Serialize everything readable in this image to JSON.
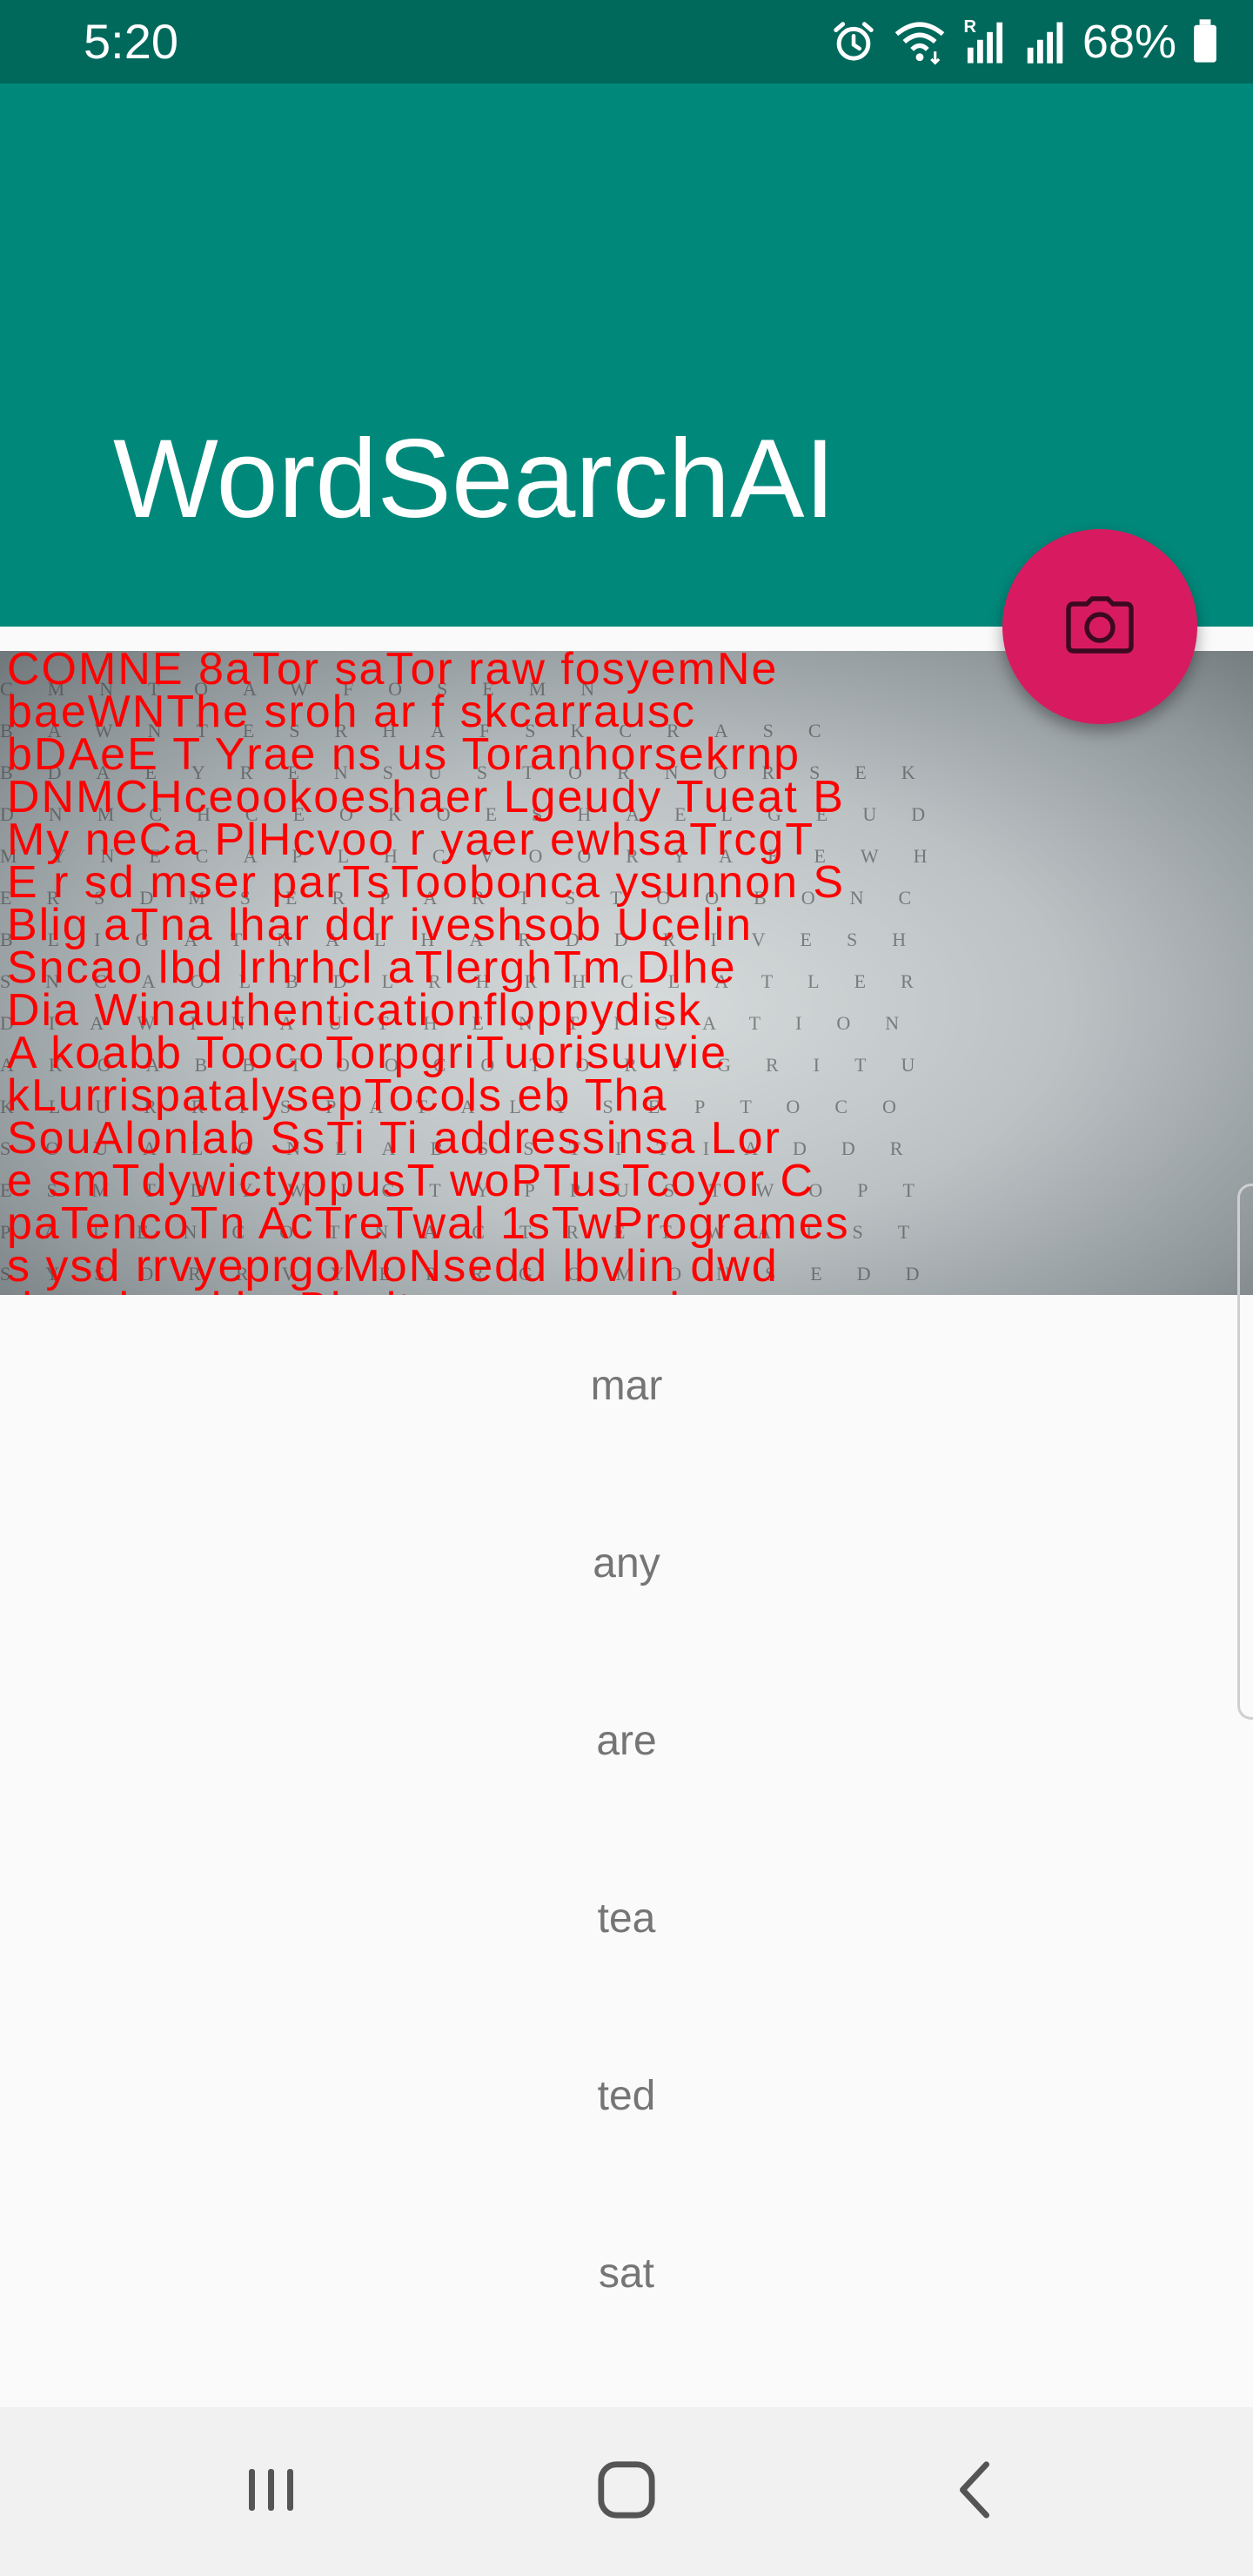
{
  "status_bar": {
    "time": "5:20",
    "battery_percent": "68%",
    "icons": [
      "alarm-icon",
      "wifi-icon",
      "signal-roaming-icon",
      "signal-icon",
      "battery-icon"
    ]
  },
  "app_bar": {
    "title": "WordSearchAI",
    "background_color": "#00897b",
    "status_bar_color": "#00695c"
  },
  "fab": {
    "icon": "camera-icon",
    "color": "#d81b60"
  },
  "ocr_overlay": {
    "color": "#ff0000",
    "lines": [
      "COMNE 8aTor saTor  raw  fosyemNe",
      "baeWNThe sroh  ar f  skcarrausc",
      "bDAeE T Yrae ns us Toranhorsekrnp",
      " DNMCHceookoeshaer Lgeudy Tueat B",
      "My  neCa PlHcvoo   r yaer ewhsaTrcgT",
      " E r sd mser parTsToobonca   ysunnon S",
      "Blig  aTna lhar ddr iveshsob Ucelin",
      "Sncao lbd lrhrhcl aTlerghTm Dlhe",
      "  Dia Winauthenticationfloppydisk",
      " A  koabb   ToocoTorpgriTuorisuuvie",
      "kLurrispatalysepTocols eb  Tha",
      "SouAlonlab SsTi Ti addressinsa Lor",
      " e smTdywictyppusT woPTusTcoyor C",
      "paTencoTn  AcTreTwal 1sTwProgrames",
      " s ysd rrvyeprgoMoNsedd  lbvlin dwd",
      "dra aby ekinsBioritrprvsor acs ismc"
    ]
  },
  "word_list": {
    "items": [
      "mar",
      "any",
      "are",
      "tea",
      "ted",
      "sat"
    ]
  },
  "nav_bar": {
    "buttons": [
      "recents-icon",
      "home-icon",
      "back-icon"
    ]
  }
}
